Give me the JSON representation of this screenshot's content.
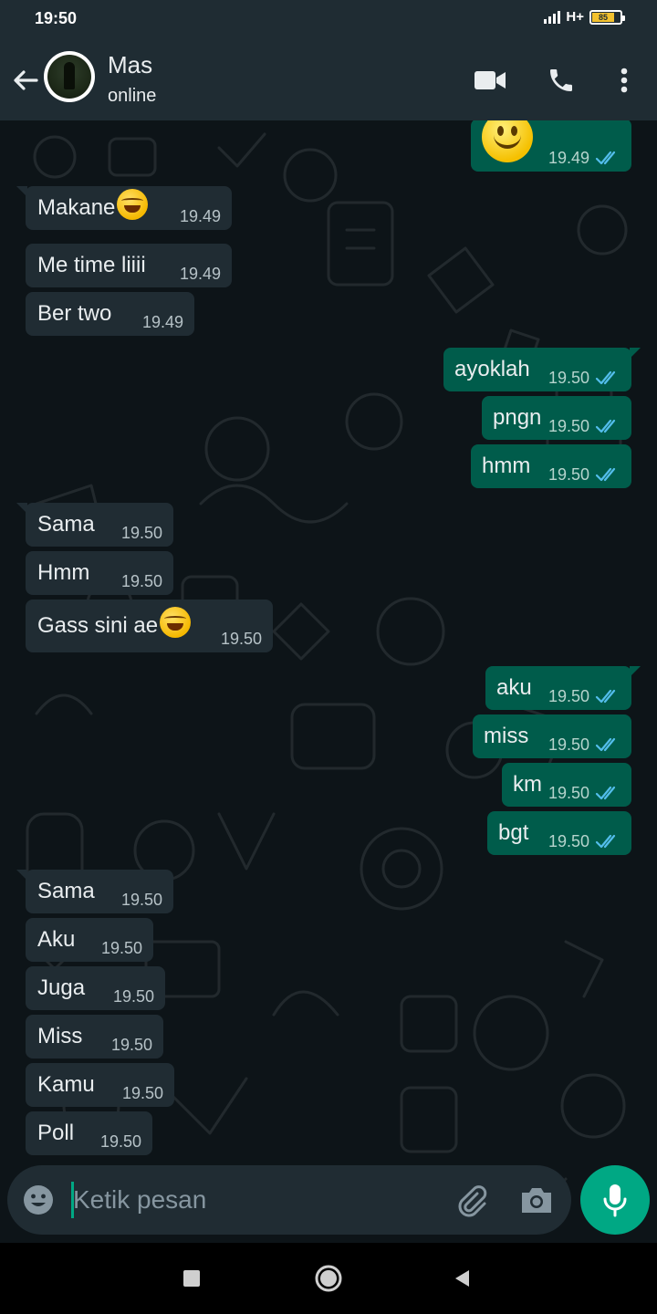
{
  "status_bar": {
    "time": "19:50",
    "network": "H+",
    "battery": "85"
  },
  "header": {
    "name": "Mas",
    "status": "online"
  },
  "messages": [
    {
      "dir": "out",
      "text": "",
      "emoji": "smile",
      "time": "19.49",
      "read": true
    },
    {
      "dir": "in",
      "text": "Makane",
      "emoji": "laugh",
      "time": "19.49"
    },
    {
      "dir": "in",
      "text": "Me time liiii",
      "time": "19.49"
    },
    {
      "dir": "in",
      "text": "Ber two",
      "time": "19.49"
    },
    {
      "dir": "out",
      "text": "ayoklah",
      "time": "19.50",
      "read": true
    },
    {
      "dir": "out",
      "text": "pngn",
      "time": "19.50",
      "read": true
    },
    {
      "dir": "out",
      "text": "hmm",
      "time": "19.50",
      "read": true
    },
    {
      "dir": "in",
      "text": "Sama",
      "time": "19.50"
    },
    {
      "dir": "in",
      "text": "Hmm",
      "time": "19.50"
    },
    {
      "dir": "in",
      "text": "Gass sini ae",
      "emoji": "laugh",
      "time": "19.50"
    },
    {
      "dir": "out",
      "text": "aku",
      "time": "19.50",
      "read": true
    },
    {
      "dir": "out",
      "text": "miss",
      "time": "19.50",
      "read": true
    },
    {
      "dir": "out",
      "text": "km",
      "time": "19.50",
      "read": true
    },
    {
      "dir": "out",
      "text": "bgt",
      "time": "19.50",
      "read": true
    },
    {
      "dir": "in",
      "text": "Sama",
      "time": "19.50"
    },
    {
      "dir": "in",
      "text": "Aku",
      "time": "19.50"
    },
    {
      "dir": "in",
      "text": "Juga",
      "time": "19.50"
    },
    {
      "dir": "in",
      "text": "Miss",
      "time": "19.50"
    },
    {
      "dir": "in",
      "text": "Kamu",
      "time": "19.50"
    },
    {
      "dir": "in",
      "text": "Poll",
      "time": "19.50"
    }
  ],
  "composer": {
    "placeholder": "Ketik pesan"
  },
  "colors": {
    "header": "#1f2c33",
    "bubble_in": "#202c33",
    "bubble_out": "#005c4b",
    "accent": "#00a884",
    "read_tick": "#53bdeb"
  },
  "icons": [
    "back-arrow-icon",
    "video-call-icon",
    "phone-icon",
    "more-options-icon",
    "emoji-icon",
    "attach-icon",
    "camera-icon",
    "mic-icon",
    "nav-recents-icon",
    "nav-home-icon",
    "nav-back-icon"
  ]
}
